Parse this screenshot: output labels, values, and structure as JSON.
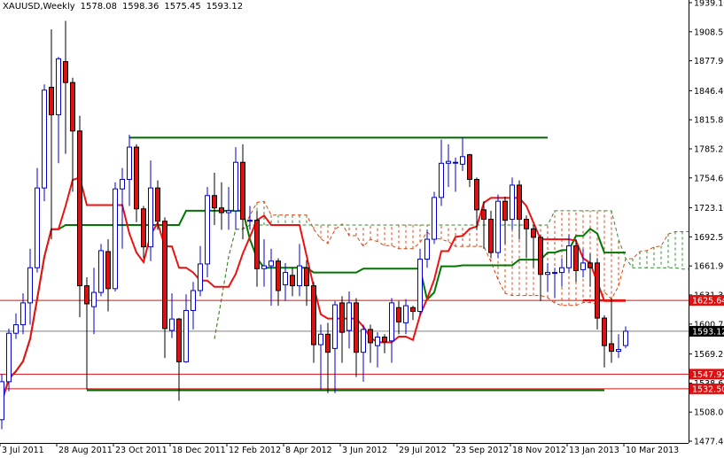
{
  "header": {
    "symbol_timeframe": "XAUUSD,Weekly",
    "open": "1578.08",
    "high": "1598.36",
    "low": "1575.45",
    "close": "1593.12"
  },
  "colors": {
    "bull": "#0000cc",
    "bear": "#dd1111",
    "tenkan": "#ee1111",
    "kijun": "#007700",
    "cloud_up": "#2e8b2e",
    "cloud_down": "#dd4411",
    "level_line": "#dd1111",
    "current_line": "#808080"
  },
  "chart_data": {
    "type": "candlestick",
    "title": "XAUUSD,Weekly",
    "indicators": [
      "Ichimoku Kinko Hyo (tenkan 9, kijun 26, senkou B 52)"
    ],
    "ylim": [
      1477.4,
      1939.1
    ],
    "y_ticks": [
      "1939.10",
      "1908.50",
      "1877.90",
      "1846.40",
      "1815.80",
      "1785.20",
      "1754.60",
      "1723.10",
      "1692.50",
      "1661.90",
      "1631.30",
      "1600.70",
      "1569.20",
      "1538.60",
      "1508.00",
      "1477.40"
    ],
    "x_ticks": [
      {
        "label": "3 Jul 2011",
        "bar": 0
      },
      {
        "label": "28 Aug 2011",
        "bar": 8
      },
      {
        "label": "23 Oct 2011",
        "bar": 16
      },
      {
        "label": "18 Dec 2011",
        "bar": 24
      },
      {
        "label": "12 Feb 2012",
        "bar": 32
      },
      {
        "label": "8 Apr 2012",
        "bar": 40
      },
      {
        "label": "3 Jun 2012",
        "bar": 48
      },
      {
        "label": "29 Jul 2012",
        "bar": 56
      },
      {
        "label": "23 Sep 2012",
        "bar": 64
      },
      {
        "label": "18 Nov 2012",
        "bar": 72
      },
      {
        "label": "13 Jan 2013",
        "bar": 80
      },
      {
        "label": "10 Mar 2013",
        "bar": 88
      }
    ],
    "ohlc": [
      [
        1500,
        1548,
        1490,
        1540
      ],
      [
        1540,
        1596,
        1530,
        1591
      ],
      [
        1591,
        1612,
        1585,
        1600
      ],
      [
        1600,
        1633,
        1590,
        1623
      ],
      [
        1623,
        1680,
        1600,
        1660
      ],
      [
        1660,
        1765,
        1655,
        1744
      ],
      [
        1744,
        1853,
        1730,
        1847
      ],
      [
        1850,
        1911,
        1690,
        1821
      ],
      [
        1821,
        1882,
        1770,
        1880
      ],
      [
        1877,
        1920,
        1780,
        1855
      ],
      [
        1855,
        1860,
        1740,
        1804
      ],
      [
        1804,
        1820,
        1608,
        1641
      ],
      [
        1641,
        1650,
        1532,
        1622
      ],
      [
        1619,
        1660,
        1590,
        1634
      ],
      [
        1634,
        1685,
        1630,
        1678
      ],
      [
        1677,
        1690,
        1614,
        1638
      ],
      [
        1638,
        1750,
        1635,
        1743
      ],
      [
        1743,
        1765,
        1680,
        1753
      ],
      [
        1753,
        1800,
        1725,
        1787
      ],
      [
        1787,
        1790,
        1708,
        1722
      ],
      [
        1722,
        1725,
        1670,
        1682
      ],
      [
        1682,
        1773,
        1667,
        1744
      ],
      [
        1744,
        1752,
        1700,
        1709
      ],
      [
        1709,
        1713,
        1565,
        1596
      ],
      [
        1594,
        1633,
        1586,
        1606
      ],
      [
        1606,
        1607,
        1520,
        1561
      ],
      [
        1561,
        1632,
        1560,
        1615
      ],
      [
        1615,
        1645,
        1595,
        1636
      ],
      [
        1636,
        1683,
        1630,
        1664
      ],
      [
        1664,
        1745,
        1650,
        1736
      ],
      [
        1736,
        1760,
        1705,
        1723
      ],
      [
        1723,
        1750,
        1700,
        1718
      ],
      [
        1718,
        1745,
        1700,
        1720
      ],
      [
        1720,
        1787,
        1700,
        1771
      ],
      [
        1771,
        1790,
        1690,
        1711
      ],
      [
        1709,
        1725,
        1700,
        1710
      ],
      [
        1710,
        1720,
        1640,
        1659
      ],
      [
        1659,
        1690,
        1640,
        1662
      ],
      [
        1662,
        1680,
        1620,
        1667
      ],
      [
        1667,
        1670,
        1620,
        1636
      ],
      [
        1642,
        1665,
        1625,
        1655
      ],
      [
        1652,
        1660,
        1630,
        1641
      ],
      [
        1641,
        1685,
        1630,
        1662
      ],
      [
        1660,
        1668,
        1620,
        1641
      ],
      [
        1641,
        1645,
        1560,
        1579
      ],
      [
        1579,
        1600,
        1532,
        1590
      ],
      [
        1590,
        1602,
        1528,
        1571
      ],
      [
        1575,
        1625,
        1528,
        1621
      ],
      [
        1623,
        1630,
        1560,
        1592
      ],
      [
        1594,
        1635,
        1575,
        1623
      ],
      [
        1623,
        1628,
        1545,
        1571
      ],
      [
        1571,
        1600,
        1540,
        1595
      ],
      [
        1595,
        1600,
        1560,
        1581
      ],
      [
        1578,
        1592,
        1555,
        1587
      ],
      [
        1587,
        1590,
        1570,
        1582
      ],
      [
        1583,
        1628,
        1560,
        1623
      ],
      [
        1618,
        1625,
        1590,
        1603
      ],
      [
        1602,
        1627,
        1590,
        1620
      ],
      [
        1618,
        1620,
        1605,
        1614
      ],
      [
        1614,
        1680,
        1610,
        1669
      ],
      [
        1669,
        1700,
        1660,
        1690
      ],
      [
        1690,
        1740,
        1685,
        1734
      ],
      [
        1734,
        1795,
        1725,
        1770
      ],
      [
        1770,
        1790,
        1745,
        1772
      ],
      [
        1771,
        1776,
        1740,
        1771
      ],
      [
        1769,
        1797,
        1762,
        1777
      ],
      [
        1779,
        1780,
        1745,
        1753
      ],
      [
        1753,
        1755,
        1700,
        1721
      ],
      [
        1721,
        1730,
        1680,
        1711
      ],
      [
        1711,
        1720,
        1670,
        1676
      ],
      [
        1676,
        1737,
        1670,
        1730
      ],
      [
        1730,
        1735,
        1685,
        1710
      ],
      [
        1711,
        1755,
        1700,
        1747
      ],
      [
        1747,
        1752,
        1690,
        1711
      ],
      [
        1711,
        1715,
        1670,
        1701
      ],
      [
        1701,
        1705,
        1660,
        1692
      ],
      [
        1692,
        1695,
        1625,
        1653
      ],
      [
        1653,
        1665,
        1635,
        1655
      ],
      [
        1655,
        1660,
        1628,
        1655
      ],
      [
        1655,
        1670,
        1640,
        1660
      ],
      [
        1660,
        1695,
        1655,
        1683
      ],
      [
        1683,
        1690,
        1645,
        1657
      ],
      [
        1658,
        1680,
        1650,
        1665
      ],
      [
        1665,
        1675,
        1640,
        1660
      ],
      [
        1665,
        1670,
        1595,
        1607
      ],
      [
        1607,
        1610,
        1555,
        1578
      ],
      [
        1580,
        1628,
        1560,
        1572
      ],
      [
        1572,
        1590,
        1565,
        1574
      ],
      [
        1578.08,
        1598.36,
        1575.45,
        1593.12
      ]
    ],
    "trend_lines": [
      {
        "name": "resistance-line",
        "price": 1797,
        "from_bar": 18,
        "to_bar": 77
      },
      {
        "name": "support-line",
        "price": 1531,
        "from_bar": 12,
        "to_bar": 85
      }
    ],
    "levels": [
      {
        "price": 1625.64,
        "label": "1625.64",
        "type": "level"
      },
      {
        "price": 1547.92,
        "label": "1547.92",
        "type": "level"
      },
      {
        "price": 1532.5,
        "label": "1532.50",
        "type": "level"
      },
      {
        "price": 1593.12,
        "label": "1593.12",
        "type": "current"
      }
    ]
  }
}
